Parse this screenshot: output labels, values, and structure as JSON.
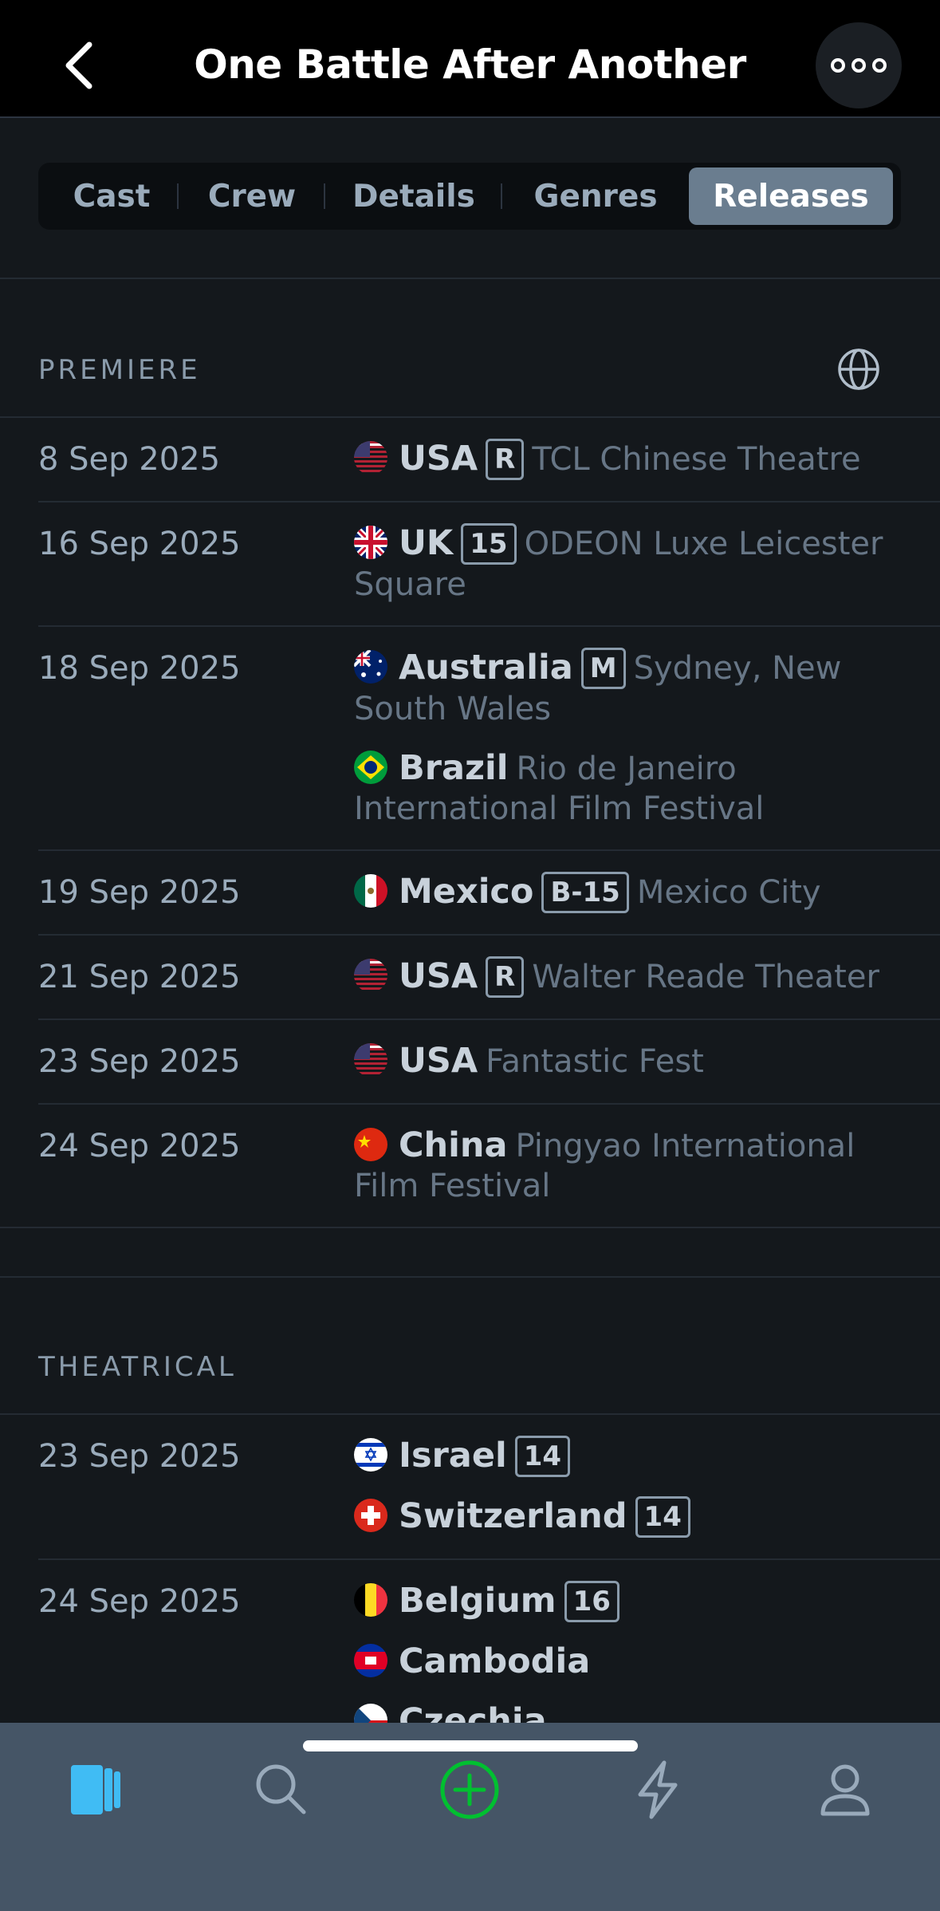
{
  "header": {
    "title": "One Battle After Another",
    "back_icon": "chevron-left-icon",
    "more_icon": "more-dots-icon"
  },
  "tabs": [
    {
      "label": "Cast",
      "active": false
    },
    {
      "label": "Crew",
      "active": false
    },
    {
      "label": "Details",
      "active": false
    },
    {
      "label": "Genres",
      "active": false
    },
    {
      "label": "Releases",
      "active": true
    }
  ],
  "premiere": {
    "label": "PREMIERE",
    "globe_icon": "globe-icon",
    "rows": [
      {
        "date": "8 Sep 2025",
        "entries": [
          {
            "country": "USA",
            "cert": "R",
            "note": "TCL Chinese Theatre"
          }
        ]
      },
      {
        "date": "16 Sep 2025",
        "entries": [
          {
            "country": "UK",
            "cert": "15",
            "note": "ODEON Luxe Leicester Square"
          }
        ]
      },
      {
        "date": "18 Sep 2025",
        "entries": [
          {
            "country": "Australia",
            "cert": "M",
            "note": "Sydney, New South Wales"
          },
          {
            "country": "Brazil",
            "cert": "",
            "note": "Rio de Janeiro International Film Festival"
          }
        ]
      },
      {
        "date": "19 Sep 2025",
        "entries": [
          {
            "country": "Mexico",
            "cert": "B-15",
            "note": "Mexico City"
          }
        ]
      },
      {
        "date": "21 Sep 2025",
        "entries": [
          {
            "country": "USA",
            "cert": "R",
            "note": "Walter Reade Theater"
          }
        ]
      },
      {
        "date": "23 Sep 2025",
        "entries": [
          {
            "country": "USA",
            "cert": "",
            "note": "Fantastic Fest"
          }
        ]
      },
      {
        "date": "24 Sep 2025",
        "entries": [
          {
            "country": "China",
            "cert": "",
            "note": "Pingyao International Film Festival"
          }
        ]
      }
    ]
  },
  "theatrical": {
    "label": "THEATRICAL",
    "rows": [
      {
        "date": "23 Sep 2025",
        "entries": [
          {
            "country": "Israel",
            "cert": "14",
            "note": ""
          },
          {
            "country": "Switzerland",
            "cert": "14",
            "note": ""
          }
        ]
      },
      {
        "date": "24 Sep 2025",
        "entries": [
          {
            "country": "Belgium",
            "cert": "16",
            "note": ""
          },
          {
            "country": "Cambodia",
            "cert": "",
            "note": ""
          },
          {
            "country": "Czechia",
            "cert": "",
            "note": ""
          }
        ]
      }
    ]
  },
  "bottom_nav": [
    {
      "icon": "films-icon",
      "active": true
    },
    {
      "icon": "search-icon",
      "active": false
    },
    {
      "icon": "add-icon",
      "active": false
    },
    {
      "icon": "activity-icon",
      "active": false
    },
    {
      "icon": "profile-icon",
      "active": false
    }
  ],
  "colors": {
    "background": "#14181c",
    "accent_green": "#00c030",
    "accent_blue": "#40bcf4",
    "nav_bar": "#455566"
  }
}
